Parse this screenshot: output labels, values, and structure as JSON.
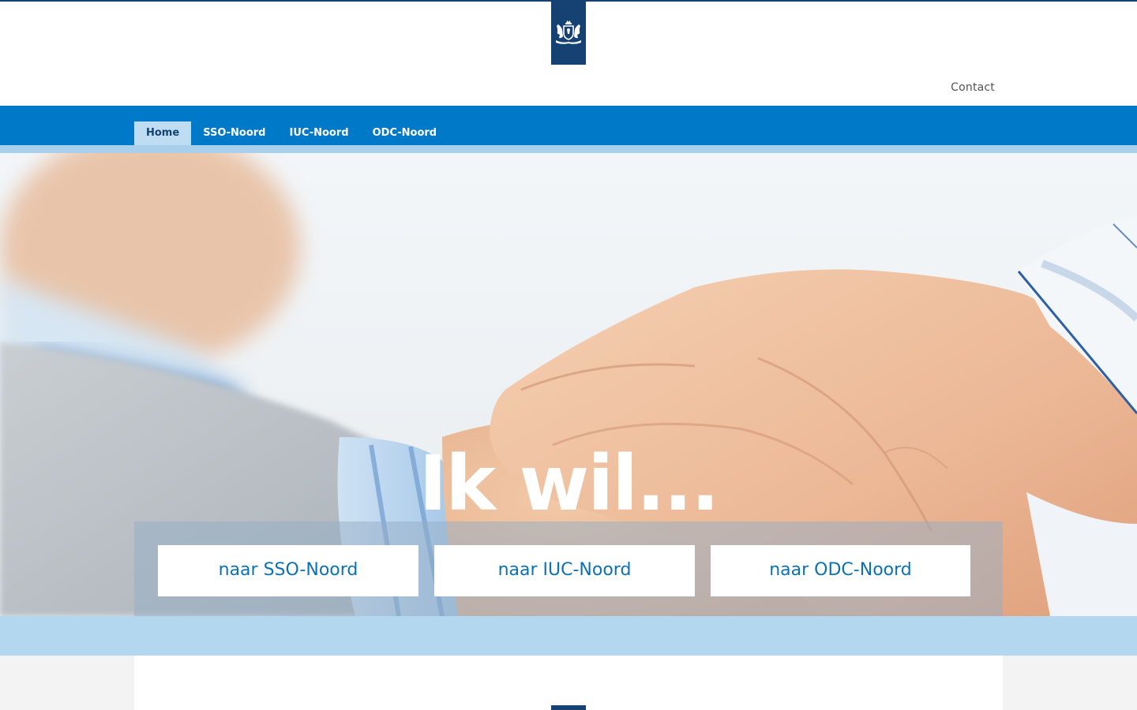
{
  "header": {
    "logo_name": "rijksoverheid-logo",
    "contact_label": "Contact"
  },
  "nav": {
    "items": [
      {
        "label": "Home",
        "active": true
      },
      {
        "label": "SSO-Noord",
        "active": false
      },
      {
        "label": "IUC-Noord",
        "active": false
      },
      {
        "label": "ODC-Noord",
        "active": false
      }
    ]
  },
  "hero": {
    "title": "Ik wil...",
    "buttons": [
      {
        "label": "naar SSO-Noord"
      },
      {
        "label": "naar IUC-Noord"
      },
      {
        "label": "naar ODC-Noord"
      }
    ]
  },
  "colors": {
    "brand_dark": "#154273",
    "nav_blue": "#0079c8",
    "light_blue": "#b3d7ee",
    "button_text": "#0b71b7"
  }
}
